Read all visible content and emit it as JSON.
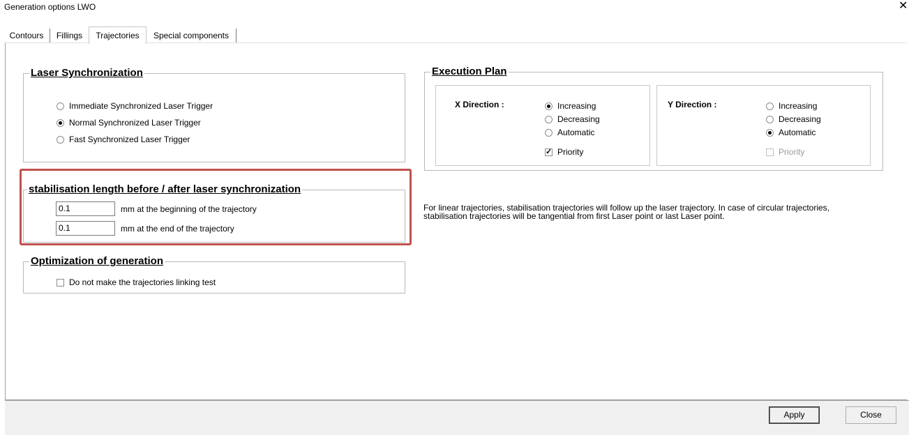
{
  "window": {
    "title": "Generation options LWO",
    "close_glyph": "✕"
  },
  "tabs": [
    {
      "label": "Contours",
      "active": false
    },
    {
      "label": "Fillings",
      "active": false
    },
    {
      "label": "Trajectories",
      "active": true
    },
    {
      "label": "Special components",
      "active": false
    }
  ],
  "laser_sync": {
    "title": "Laser Synchronization",
    "options": [
      {
        "label": "Immediate Synchronized Laser Trigger",
        "selected": false
      },
      {
        "label": "Normal Synchronized Laser Trigger",
        "selected": true
      },
      {
        "label": "Fast Synchronized Laser Trigger",
        "selected": false
      }
    ]
  },
  "stabilisation": {
    "title": "stabilisation length before / after laser synchronization",
    "begin_value": "0.1",
    "begin_label": "mm at the beginning of the trajectory",
    "end_value": "0.1",
    "end_label": "mm at the end of the trajectory"
  },
  "optimization": {
    "title": "Optimization of generation",
    "checkbox_label": "Do not make the trajectories linking test",
    "checked": false
  },
  "execution_plan": {
    "title": "Execution Plan",
    "x": {
      "label": "X Direction :",
      "options": [
        "Increasing",
        "Decreasing",
        "Automatic"
      ],
      "selected": "Increasing",
      "priority_label": "Priority",
      "priority_checked": true
    },
    "y": {
      "label": "Y Direction :",
      "options": [
        "Increasing",
        "Decreasing",
        "Automatic"
      ],
      "selected": "Automatic",
      "priority_label": "Priority",
      "priority_checked": false,
      "priority_disabled": true
    }
  },
  "info_text": {
    "line1": "For linear trajectories, stabilisation trajectories will follow up the laser trajectory. In case of circular trajectories,",
    "line2": "stabilisation trajectories will be tangential from first Laser point or last Laser point."
  },
  "buttons": {
    "apply": "Apply",
    "close": "Close"
  },
  "colors": {
    "highlight": "#c0504d",
    "footer_bg": "#f0f0f0"
  }
}
